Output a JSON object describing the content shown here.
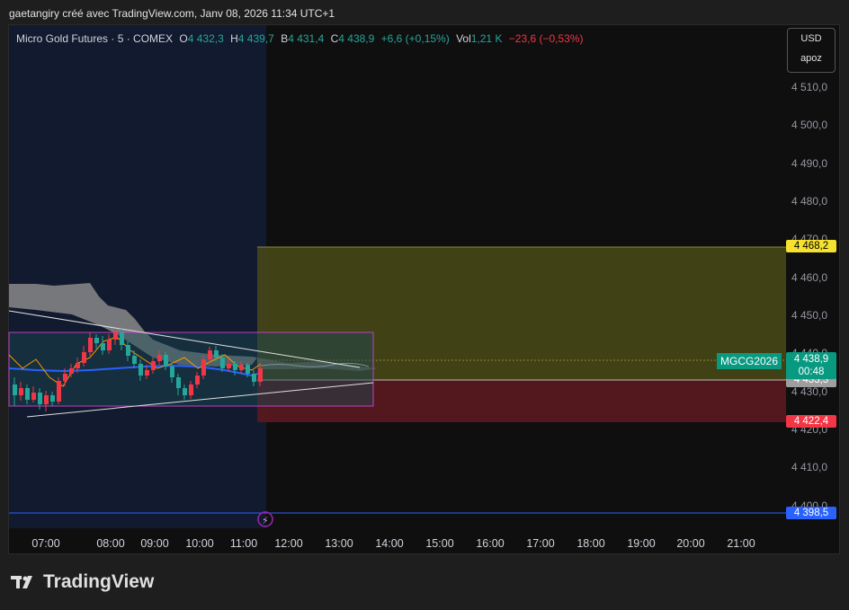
{
  "credit": "gaetangiry créé avec TradingView.com, Janv 08, 2026 11:34 UTC+1",
  "legend": {
    "title": "Micro Gold Futures · 5 · COMEX",
    "o_key": "O",
    "o_val": "4 432,3",
    "h_key": "H",
    "h_val": "4 439,7",
    "b_key": "B",
    "b_val": "4 431,4",
    "c_key": "C",
    "c_val": "4 438,9",
    "change": "+6,6 (+0,15%)",
    "vol_key": "Vol",
    "vol_val": "1,21 K",
    "vol_change": "−23,6 (−0,53%)"
  },
  "currency": {
    "code": "USD",
    "unit": "apoz"
  },
  "price_axis": [
    "4 510,0",
    "4 500,0",
    "4 490,0",
    "4 480,0",
    "4 470,0",
    "4 460,0",
    "4 450,0",
    "4 440,0",
    "4 430,0",
    "4 420,0",
    "4 410,0",
    "4 400,0"
  ],
  "price_tags": {
    "target": "4 468,2",
    "current": "4 438,9",
    "countdown": "00:48",
    "entry": "4 433,3",
    "stop": "4 422,4",
    "line": "4 398,5"
  },
  "symbol_tag": "MGCG2026",
  "time_axis": [
    "07:00",
    "08:00",
    "09:00",
    "10:00",
    "11:00",
    "12:00",
    "13:00",
    "14:00",
    "15:00",
    "16:00",
    "17:00",
    "18:00",
    "19:00",
    "20:00",
    "21:00"
  ],
  "footer": {
    "brand": "TradingView"
  },
  "colors": {
    "up": "#26a69a",
    "down": "#f23645",
    "target_zone": "#4a4a18",
    "stop_zone": "#5a1a1f",
    "line": "#2962ff",
    "range_box": "#c040c0"
  }
}
